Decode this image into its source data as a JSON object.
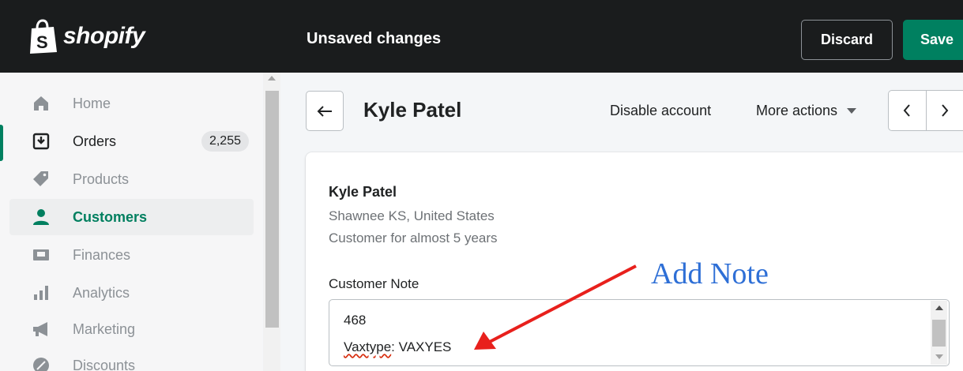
{
  "topbar": {
    "brand": "shopify",
    "status": "Unsaved changes",
    "discard_label": "Discard",
    "save_label": "Save",
    "save_color": "#008060"
  },
  "sidebar": {
    "items": [
      {
        "label": "Home",
        "icon": "home-icon"
      },
      {
        "label": "Orders",
        "icon": "orders-icon",
        "badge": "2,255"
      },
      {
        "label": "Products",
        "icon": "tag-icon"
      },
      {
        "label": "Customers",
        "icon": "person-icon",
        "active": true
      },
      {
        "label": "Finances",
        "icon": "finances-icon"
      },
      {
        "label": "Analytics",
        "icon": "bar-chart-icon"
      },
      {
        "label": "Marketing",
        "icon": "megaphone-icon"
      },
      {
        "label": "Discounts",
        "icon": "discount-icon"
      }
    ],
    "active_color": "#007f5f"
  },
  "page": {
    "title": "Kyle Patel",
    "disable_label": "Disable account",
    "more_actions_label": "More actions"
  },
  "customer": {
    "name": "Kyle Patel",
    "location": "Shawnee KS, United States",
    "tenure": "Customer for almost 5 years",
    "note_label": "Customer Note",
    "note_line1": "468",
    "note_line2_word": "Vaxtype",
    "note_line2_rest": ": VAXYES"
  },
  "annotation": {
    "text": "Add Note",
    "text_color": "#2e6fd6",
    "arrow_color": "#e8201c"
  }
}
